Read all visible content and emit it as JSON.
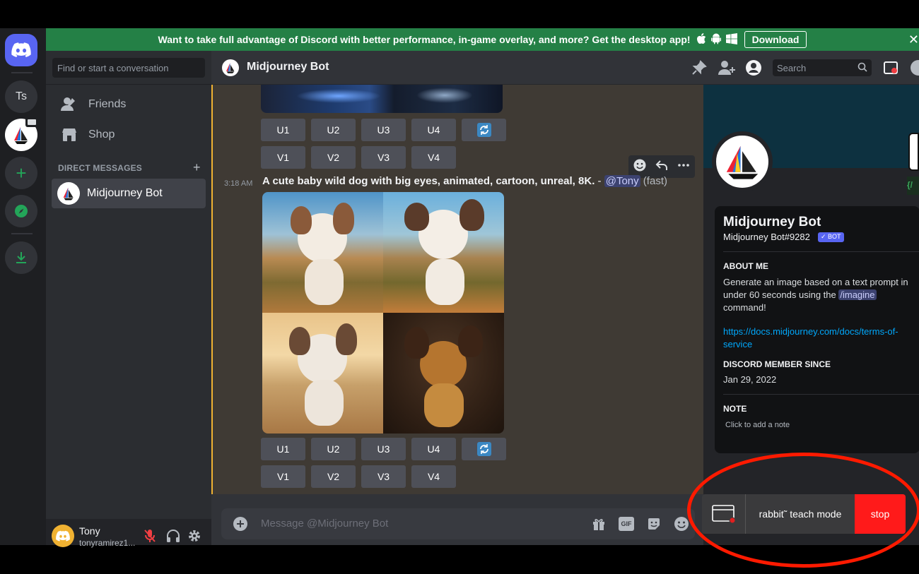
{
  "banner": {
    "text": "Want to take full advantage of Discord with better performance, in-game overlay, and more? Get the desktop app!",
    "button": "Download"
  },
  "rail": {
    "ts_label": "Ts"
  },
  "sidebar": {
    "search_placeholder": "Find or start a conversation",
    "friends": "Friends",
    "shop": "Shop",
    "dm_header": "DIRECT MESSAGES",
    "dm_items": [
      {
        "label": "Midjourney Bot"
      }
    ]
  },
  "user": {
    "name": "Tony",
    "tag": "tonyramirez1..."
  },
  "chat": {
    "title": "Midjourney Bot",
    "search_placeholder": "Search",
    "upscale_buttons": [
      "U1",
      "U2",
      "U3",
      "U4"
    ],
    "variation_buttons": [
      "V1",
      "V2",
      "V3",
      "V4"
    ],
    "message": {
      "time": "3:18 AM",
      "text": "A cute baby wild dog with big eyes, animated, cartoon, unreal, 8K.",
      "separator": " - ",
      "mention": "@Tony",
      "suffix": " (fast)"
    },
    "composer_placeholder": "Message @Midjourney Bot"
  },
  "profile": {
    "name": "Midjourney Bot",
    "tag": "Midjourney Bot#9282",
    "badge": "BOT",
    "about_label": "ABOUT ME",
    "about_text_1": "Generate an image based on a text prompt in under 60 seconds using the",
    "about_cmd": "/imagine",
    "about_text_2": "command!",
    "link": "https://docs.midjourney.com/docs/terms-of-service",
    "member_label": "DISCORD MEMBER SINCE",
    "member_date": "Jan 29, 2022",
    "note_label": "NOTE",
    "note_placeholder": "Click to add a note"
  },
  "rabbit": {
    "label": "rabbit˜ teach mode",
    "stop": "stop"
  },
  "colors": {
    "accent": "#f0b232",
    "banner": "#248046",
    "stop": "#ff1a1a",
    "highlight": "#ff1a00"
  }
}
